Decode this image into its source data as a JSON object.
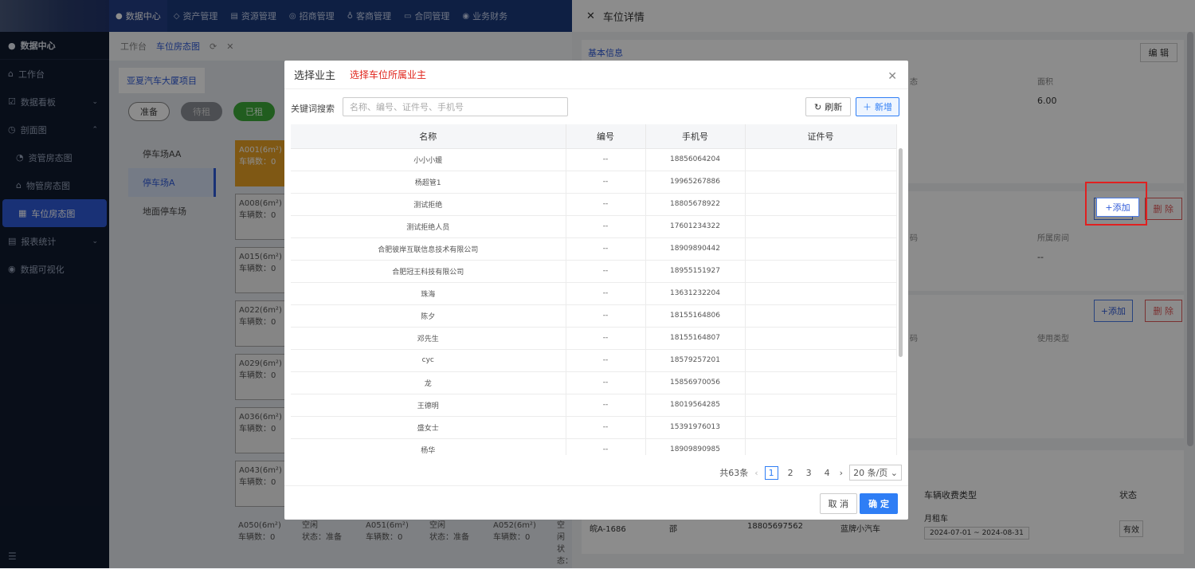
{
  "topnav": {
    "items": [
      {
        "icon": "globe-icon",
        "label": "数据中心"
      },
      {
        "icon": "cube-icon",
        "label": "资产管理"
      },
      {
        "icon": "document-icon",
        "label": "资源管理"
      },
      {
        "icon": "flag-icon",
        "label": "招商管理"
      },
      {
        "icon": "users-icon",
        "label": "客商管理"
      },
      {
        "icon": "contract-icon",
        "label": "合同管理"
      },
      {
        "icon": "money-icon",
        "label": "业务财务"
      }
    ]
  },
  "sidebar": {
    "header": "数据中心",
    "items": [
      {
        "label": "工作台"
      },
      {
        "label": "数据看板"
      },
      {
        "label": "剖面图"
      },
      {
        "label": "资管房态图"
      },
      {
        "label": "物管房态图"
      },
      {
        "label": "车位房态图"
      },
      {
        "label": "报表统计"
      },
      {
        "label": "数据可视化"
      }
    ]
  },
  "main": {
    "tabs": [
      "工作台",
      "车位房态图"
    ],
    "project": "亚夏汽车大厦项目",
    "pills": [
      "准备",
      "待租",
      "已租"
    ],
    "parks": [
      "停车场AA",
      "停车场A",
      "地面停车场"
    ],
    "slots": [
      {
        "code": "A001(6m²)",
        "info": "车辆数：0"
      },
      {
        "code": "A008(6m²)",
        "info": "车辆数：0"
      },
      {
        "code": "A015(6m²)",
        "info": "车辆数：0"
      },
      {
        "code": "A022(6m²)",
        "info": "车辆数：0"
      },
      {
        "code": "A029(6m²)",
        "info": "车辆数：0"
      },
      {
        "code": "A036(6m²)",
        "info": "车辆数：0"
      },
      {
        "code": "A043(6m²)",
        "info": "车辆数：0"
      }
    ],
    "bottom_row": [
      {
        "a": "A050(6m²)",
        "b": "车辆数：0"
      },
      {
        "a": "空闲",
        "b": "状态：准备"
      },
      {
        "a": "A051(6m²)",
        "b": "车辆数：0"
      },
      {
        "a": "空闲",
        "b": "状态：准备"
      },
      {
        "a": "A052(6m²)",
        "b": "车辆数：0"
      },
      {
        "a": "空闲",
        "b": "状态："
      }
    ]
  },
  "drawer": {
    "title": "车位详情",
    "basic_info": "基本信息",
    "edit": "编 辑",
    "status_label_partial": "态",
    "area_label": "面积",
    "area_value": "6.00",
    "code_label_partial": "码",
    "room_label": "所属房间",
    "room_value": "--",
    "usage_label": "使用类型",
    "add": "+添加",
    "delete": "删 除",
    "fee_type_header": "车辆收费类型",
    "status_header": "状态",
    "row": {
      "plate": "皖A-1686",
      "name": "邵",
      "phone": "18805697562",
      "car_type": "蓝牌小汽车",
      "fee": "月租车",
      "period": "2024-07-01 ~ 2024-08-31",
      "status": "有效"
    }
  },
  "dialog": {
    "title": "选择业主",
    "subtitle": "选择车位所属业主",
    "search_label": "关键词搜索",
    "search_placeholder": "名称、编号、证件号、手机号",
    "refresh": "刷新",
    "new": "新增",
    "columns": [
      "名称",
      "编号",
      "手机号",
      "证件号"
    ],
    "rows": [
      {
        "name": "小小小媛",
        "code": "--",
        "phone": "18856064204",
        "cert": ""
      },
      {
        "name": "杨超管1",
        "code": "--",
        "phone": "19965267886",
        "cert": ""
      },
      {
        "name": "测试拒绝",
        "code": "--",
        "phone": "18805678922",
        "cert": ""
      },
      {
        "name": "测试拒绝人员",
        "code": "--",
        "phone": "17601234322",
        "cert": ""
      },
      {
        "name": "合肥彼岸互联信息技术有限公司",
        "code": "--",
        "phone": "18909890442",
        "cert": ""
      },
      {
        "name": "合肥冠王科技有限公司",
        "code": "--",
        "phone": "18955151927",
        "cert": ""
      },
      {
        "name": "珠海",
        "code": "--",
        "phone": "13631232204",
        "cert": ""
      },
      {
        "name": "陈夕",
        "code": "--",
        "phone": "18155164806",
        "cert": ""
      },
      {
        "name": "邓先生",
        "code": "--",
        "phone": "18155164807",
        "cert": ""
      },
      {
        "name": "cyc",
        "code": "--",
        "phone": "18579257201",
        "cert": ""
      },
      {
        "name": "龙",
        "code": "--",
        "phone": "15856970056",
        "cert": ""
      },
      {
        "name": "王德明",
        "code": "--",
        "phone": "18019564285",
        "cert": ""
      },
      {
        "name": "盛女士",
        "code": "--",
        "phone": "15391976013",
        "cert": ""
      },
      {
        "name": "杨华",
        "code": "--",
        "phone": "18909890985",
        "cert": ""
      }
    ],
    "pager": {
      "total": "共63条",
      "pages": [
        "1",
        "2",
        "3",
        "4"
      ],
      "current": "1",
      "page_size": "20 条/页"
    },
    "cancel": "取 消",
    "ok": "确 定"
  }
}
